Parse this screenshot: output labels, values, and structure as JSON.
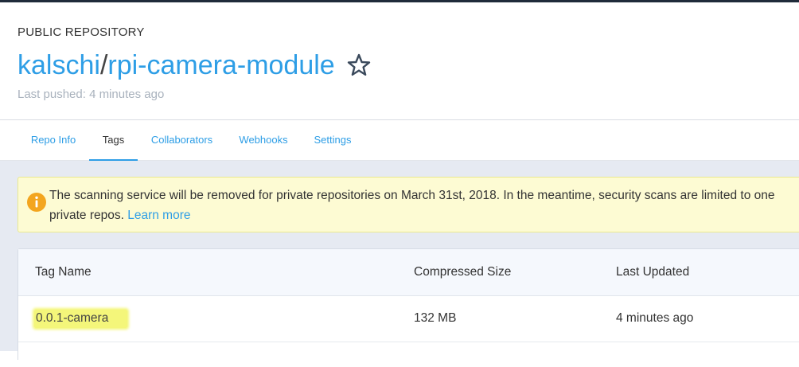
{
  "header": {
    "visibility": "PUBLIC REPOSITORY",
    "namespace": "kalschi",
    "separator": "/",
    "repo_name": "rpi-camera-module",
    "last_pushed": "Last pushed: 4 minutes ago"
  },
  "tabs": [
    {
      "label": "Repo Info",
      "active": false
    },
    {
      "label": "Tags",
      "active": true
    },
    {
      "label": "Collaborators",
      "active": false
    },
    {
      "label": "Webhooks",
      "active": false
    },
    {
      "label": "Settings",
      "active": false
    }
  ],
  "notice": {
    "line1": "The scanning service will be removed for private repositories on March 31st, 2018. In the meantime, security scans are limited to one",
    "line2": "private repos.",
    "link": "Learn more",
    "icon": "info-icon"
  },
  "table": {
    "columns": [
      "Tag Name",
      "Compressed Size",
      "Last Updated"
    ],
    "rows": [
      {
        "tag": "0.0.1-camera",
        "size": "132 MB",
        "updated": "4 minutes ago"
      }
    ]
  },
  "colors": {
    "accent": "#2e9ee6",
    "notice_bg": "#fdfbd3",
    "highlight": "#f4f67a",
    "page_bg": "#e6eaf2"
  }
}
